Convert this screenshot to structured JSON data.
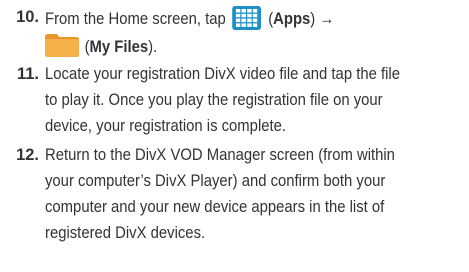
{
  "steps": [
    {
      "number": "10.",
      "line1": {
        "prefix": "From the Home screen, tap ",
        "paren_open": " (",
        "apps_label": "Apps",
        "paren_close": ") ",
        "arrow": "→"
      },
      "line2": {
        "paren_open": "(",
        "myfiles_label": "My Files",
        "paren_close": ")."
      }
    },
    {
      "number": "11.",
      "lines": [
        "Locate your registration DivX video file and tap the file",
        "to play it. Once you play the registration file on your",
        "device, your registration is complete."
      ]
    },
    {
      "number": "12.",
      "lines": [
        "Return to the DivX VOD Manager screen (from within",
        "your computer’s DivX Player) and confirm both your",
        "computer and your new device appears in the list of",
        "registered DivX devices."
      ]
    }
  ],
  "icons": {
    "apps": "apps-grid-icon",
    "my_files": "folder-icon"
  },
  "colors": {
    "text": "#333333",
    "apps_icon_bg": "#1f8fc8",
    "folder": "#f0a53a"
  }
}
